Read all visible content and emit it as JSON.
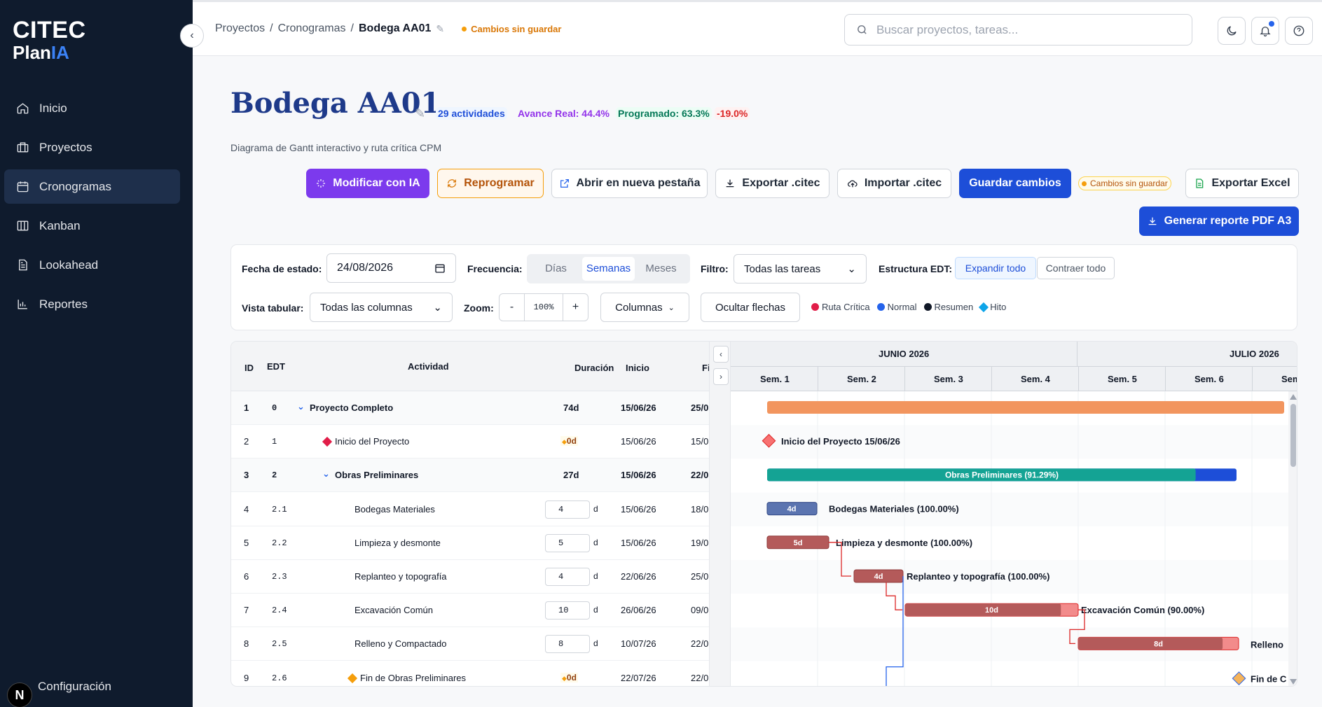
{
  "brand": {
    "line1": "CITEC",
    "line2_a": "Plan",
    "line2_b": "IA"
  },
  "sidebar": {
    "items": [
      {
        "label": "Inicio",
        "icon": "home-icon"
      },
      {
        "label": "Proyectos",
        "icon": "briefcase-icon"
      },
      {
        "label": "Cronogramas",
        "icon": "calendar-icon",
        "active": true
      },
      {
        "label": "Kanban",
        "icon": "kanban-icon"
      },
      {
        "label": "Lookahead",
        "icon": "document-icon"
      },
      {
        "label": "Reportes",
        "icon": "bar-chart-icon"
      }
    ],
    "config_label": "Configuración",
    "avatar_letter": "N"
  },
  "header": {
    "breadcrumb": [
      "Proyectos",
      "Cronogramas",
      "Bodega AA01"
    ],
    "unsaved": "Cambios sin guardar",
    "search_placeholder": "Buscar proyectos, tareas..."
  },
  "page": {
    "title": "Bodega AA01",
    "activities": "29 actividades",
    "avance_real": "Avance Real: 44.4%",
    "programado": "Programado: 63.3%",
    "delta": "-19.0%",
    "subtitle": "Diagrama de Gantt interactivo y ruta crítica CPM"
  },
  "toolbar": {
    "ai": "Modificar con IA",
    "reprogramar": "Reprogramar",
    "open_tab": "Abrir en nueva pestaña",
    "export_citec": "Exportar .citec",
    "import_citec": "Importar .citec",
    "save": "Guardar cambios",
    "unsaved": "Cambios sin guardar",
    "export_excel": "Exportar Excel",
    "pdf": "Generar reporte PDF A3"
  },
  "filters": {
    "fecha_label": "Fecha de estado:",
    "fecha_value": "24/08/2026",
    "frecuencia_label": "Frecuencia:",
    "frecuencia_options": [
      "Días",
      "Semanas",
      "Meses"
    ],
    "filtro_label": "Filtro:",
    "filtro_value": "Todas las tareas",
    "edt_label": "Estructura EDT:",
    "expand": "Expandir todo",
    "collapse": "Contraer todo",
    "vista_label": "Vista tabular:",
    "vista_value": "Todas las columnas",
    "zoom_label": "Zoom:",
    "zoom_minus": "-",
    "zoom_value": "100%",
    "zoom_plus": "+",
    "columnas": "Columnas",
    "ocultar": "Ocultar flechas",
    "legend": [
      {
        "label": "Ruta Crítica",
        "color": "#e11d48"
      },
      {
        "label": "Normal",
        "color": "#2563eb"
      },
      {
        "label": "Resumen",
        "color": "#111827"
      },
      {
        "label": "Hito",
        "color": "#0ea5e9"
      }
    ]
  },
  "table": {
    "headers": {
      "id": "ID",
      "edt": "EDT",
      "actividad": "Actividad",
      "duracion": "Duración",
      "inicio": "Inicio",
      "fin": "Fi"
    },
    "rows": [
      {
        "id": "1",
        "edt": "0",
        "name": "Proyecto Completo",
        "dur": "74d",
        "start": "15/06/26",
        "end": "25/0",
        "type": "summary",
        "level": 0
      },
      {
        "id": "2",
        "edt": "1",
        "name": "Inicio del Proyecto",
        "dur": "0d",
        "start": "15/06/26",
        "end": "15/0",
        "type": "milestone",
        "level": 1
      },
      {
        "id": "3",
        "edt": "2",
        "name": "Obras Preliminares",
        "dur": "27d",
        "start": "15/06/26",
        "end": "22/0",
        "type": "summary",
        "level": 1
      },
      {
        "id": "4",
        "edt": "2.1",
        "name": "Bodegas Materiales",
        "dur": "4",
        "start": "15/06/26",
        "end": "18/0",
        "type": "task",
        "level": 2
      },
      {
        "id": "5",
        "edt": "2.2",
        "name": "Limpieza y desmonte",
        "dur": "5",
        "start": "15/06/26",
        "end": "19/0",
        "type": "task",
        "level": 2
      },
      {
        "id": "6",
        "edt": "2.3",
        "name": "Replanteo y topografía",
        "dur": "4",
        "start": "22/06/26",
        "end": "25/0",
        "type": "task",
        "level": 2
      },
      {
        "id": "7",
        "edt": "2.4",
        "name": "Excavación Común",
        "dur": "10",
        "start": "26/06/26",
        "end": "09/0",
        "type": "task",
        "level": 2
      },
      {
        "id": "8",
        "edt": "2.5",
        "name": "Relleno y Compactado",
        "dur": "8",
        "start": "10/07/26",
        "end": "22/0",
        "type": "task",
        "level": 2
      },
      {
        "id": "9",
        "edt": "2.6",
        "name": "Fin de Obras Preliminares",
        "dur": "0d",
        "start": "22/07/26",
        "end": "22/0",
        "type": "milestone",
        "level": 2
      }
    ],
    "dur_unit": "d"
  },
  "gantt": {
    "months": [
      "JUNIO 2026",
      "JULIO 2026"
    ],
    "weeks": [
      "Sem. 1",
      "Sem. 2",
      "Sem. 3",
      "Sem. 4",
      "Sem. 5",
      "Sem. 6",
      "Sem"
    ],
    "labels": {
      "milestone1": "Inicio del Proyecto 15/06/26",
      "obras": "Obras Preliminares (91.29%)",
      "bodegas_bar": "4d",
      "bodegas": "Bodegas Materiales (100.00%)",
      "limpieza_bar": "5d",
      "limpieza": "Limpieza y desmonte (100.00%)",
      "replanteo_bar": "4d",
      "replanteo": "Replanteo y topografía (100.00%)",
      "excav_bar": "10d",
      "excav": "Excavación Común (90.00%)",
      "relleno_bar": "8d",
      "relleno": "Relleno",
      "fin": "Fin de C"
    },
    "progress": {
      "obras": 0.9129,
      "excav": 0.9,
      "relleno": 0.9
    }
  }
}
